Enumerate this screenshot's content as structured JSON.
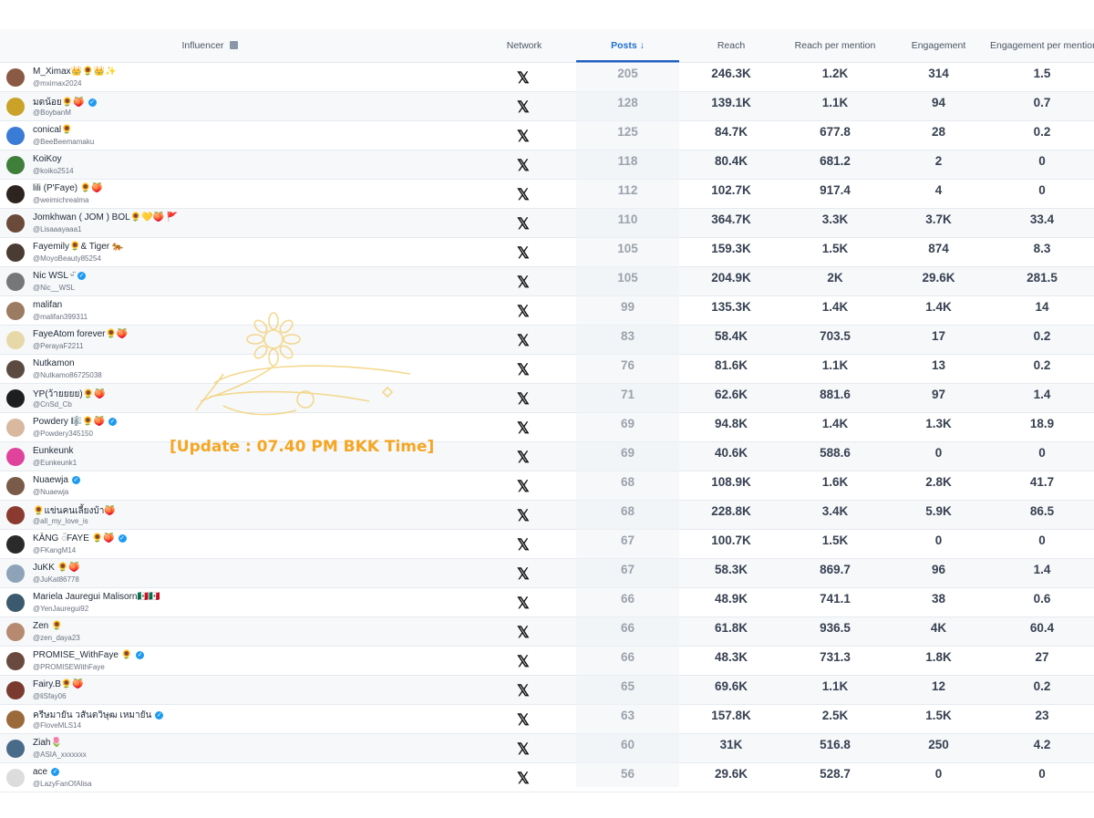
{
  "header": {
    "influencer": "Influencer",
    "network": "Network",
    "posts": "Posts",
    "posts_sort_icon": "arrow-down-icon",
    "reach": "Reach",
    "reach_per_mention": "Reach per mention",
    "engagement": "Engagement",
    "engagement_per_mention": "Engagement per mention"
  },
  "network_icon": "x-logo-icon",
  "network_glyph": "𝕏",
  "verified_glyph": "✓",
  "overlay_text": "[Update : 07.40 PM BKK Time]",
  "colors": {
    "accent": "#1f6fd1",
    "verified": "#1d9bf0",
    "overlay": "#f5a623"
  },
  "rows": [
    {
      "name": "M_Ximax👑🌻👑✨",
      "handle": "@mximax2024",
      "verified": false,
      "avatar": "#8a5a44",
      "posts": "205",
      "reach": "246.3K",
      "rpm": "1.2K",
      "eng": "314",
      "epm": "1.5"
    },
    {
      "name": "มดน้อย🌻🍑",
      "handle": "@BoybanM",
      "verified": true,
      "avatar": "#c9a227",
      "posts": "128",
      "reach": "139.1K",
      "rpm": "1.1K",
      "eng": "94",
      "epm": "0.7"
    },
    {
      "name": "conical🌻",
      "handle": "@BeeBeemamaku",
      "verified": false,
      "avatar": "#3a7bd5",
      "posts": "125",
      "reach": "84.7K",
      "rpm": "677.8",
      "eng": "28",
      "epm": "0.2"
    },
    {
      "name": "KoiKoy",
      "handle": "@koiko2514",
      "verified": false,
      "avatar": "#3f7f3a",
      "posts": "118",
      "reach": "80.4K",
      "rpm": "681.2",
      "eng": "2",
      "epm": "0"
    },
    {
      "name": "lili (P'Faye) 🌻🍑",
      "handle": "@weimichrealma",
      "verified": false,
      "avatar": "#2d2420",
      "posts": "112",
      "reach": "102.7K",
      "rpm": "917.4",
      "eng": "4",
      "epm": "0"
    },
    {
      "name": "Jomkhwan ( JOM ) BOL🌻💛🍑 🚩",
      "handle": "@Lisaaayaaa1",
      "verified": false,
      "avatar": "#6b4a3a",
      "posts": "110",
      "reach": "364.7K",
      "rpm": "3.3K",
      "eng": "3.7K",
      "epm": "33.4"
    },
    {
      "name": "Fayemily🌻& Tiger 🐅",
      "handle": "@MoyoBeauty85254",
      "verified": false,
      "avatar": "#4a3b33",
      "posts": "105",
      "reach": "159.3K",
      "rpm": "1.5K",
      "eng": "874",
      "epm": "8.3"
    },
    {
      "name": "Nic WSL ᵕ̈",
      "handle": "@Nic__WSL",
      "verified": true,
      "avatar": "#777777",
      "posts": "105",
      "reach": "204.9K",
      "rpm": "2K",
      "eng": "29.6K",
      "epm": "281.5"
    },
    {
      "name": "malifan",
      "handle": "@malifan399311",
      "verified": false,
      "avatar": "#9b7b62",
      "posts": "99",
      "reach": "135.3K",
      "rpm": "1.4K",
      "eng": "1.4K",
      "epm": "14"
    },
    {
      "name": "FayeAtom forever🌻🍑",
      "handle": "@PerayaF2211",
      "verified": false,
      "avatar": "#e7d8a8",
      "posts": "83",
      "reach": "58.4K",
      "rpm": "703.5",
      "eng": "17",
      "epm": "0.2"
    },
    {
      "name": "Nutkamon",
      "handle": "@Nutkamo86725038",
      "verified": false,
      "avatar": "#5c4a40",
      "posts": "76",
      "reach": "81.6K",
      "rpm": "1.1K",
      "eng": "13",
      "epm": "0.2"
    },
    {
      "name": "YP(ว้ายยยย)🌻🍑",
      "handle": "@CnSd_Cb",
      "verified": false,
      "avatar": "#1e1e1e",
      "posts": "71",
      "reach": "62.6K",
      "rpm": "881.6",
      "eng": "97",
      "epm": "1.4"
    },
    {
      "name": "Powdery 🎼🌻🍑",
      "handle": "@Powdery345150",
      "verified": true,
      "avatar": "#d9b8a0",
      "posts": "69",
      "reach": "94.8K",
      "rpm": "1.4K",
      "eng": "1.3K",
      "epm": "18.9"
    },
    {
      "name": "Eunkeunk",
      "handle": "@Eunkeunk1",
      "verified": false,
      "avatar": "#e0439b",
      "posts": "69",
      "reach": "40.6K",
      "rpm": "588.6",
      "eng": "0",
      "epm": "0"
    },
    {
      "name": "Nuaewja",
      "handle": "@Nuaewja",
      "verified": true,
      "avatar": "#7a5a48",
      "posts": "68",
      "reach": "108.9K",
      "rpm": "1.6K",
      "eng": "2.8K",
      "epm": "41.7"
    },
    {
      "name": "🌻แข่นคนเลี้ยงบ้า🍑",
      "handle": "@all_my_love_is",
      "verified": false,
      "avatar": "#8a3a2e",
      "posts": "68",
      "reach": "228.8K",
      "rpm": "3.4K",
      "eng": "5.9K",
      "epm": "86.5"
    },
    {
      "name": "KĀNG ◌̈FAYE 🌻🍑",
      "handle": "@FKangM14",
      "verified": true,
      "avatar": "#2a2a2a",
      "posts": "67",
      "reach": "100.7K",
      "rpm": "1.5K",
      "eng": "0",
      "epm": "0"
    },
    {
      "name": "JuKK 🌻🍑",
      "handle": "@JuKat86778",
      "verified": false,
      "avatar": "#8fa3b8",
      "posts": "67",
      "reach": "58.3K",
      "rpm": "869.7",
      "eng": "96",
      "epm": "1.4"
    },
    {
      "name": "Mariela Jauregui Malisorn🇲🇽🇲🇽",
      "handle": "@YenJauregui92",
      "verified": false,
      "avatar": "#3c5a6e",
      "posts": "66",
      "reach": "48.9K",
      "rpm": "741.1",
      "eng": "38",
      "epm": "0.6"
    },
    {
      "name": "Zen 🌻",
      "handle": "@zen_daya23",
      "verified": false,
      "avatar": "#b58a70",
      "posts": "66",
      "reach": "61.8K",
      "rpm": "936.5",
      "eng": "4K",
      "epm": "60.4"
    },
    {
      "name": "PROMISE_WithFaye 🌻",
      "handle": "@PROMISEWithFaye",
      "verified": true,
      "avatar": "#6a4a3e",
      "posts": "66",
      "reach": "48.3K",
      "rpm": "731.3",
      "eng": "1.8K",
      "epm": "27"
    },
    {
      "name": "Fairy.B🌻🍑",
      "handle": "@liSfay06",
      "verified": false,
      "avatar": "#7a3a30",
      "posts": "65",
      "reach": "69.6K",
      "rpm": "1.1K",
      "eng": "12",
      "epm": "0.2"
    },
    {
      "name": "ครีษมายัน วสันตวิษุฒ เหมายัน",
      "handle": "@FloveMLS14",
      "verified": true,
      "avatar": "#9a6a3a",
      "posts": "63",
      "reach": "157.8K",
      "rpm": "2.5K",
      "eng": "1.5K",
      "epm": "23"
    },
    {
      "name": "Ziah🌷",
      "handle": "@ASIA_xxxxxxx",
      "verified": false,
      "avatar": "#4a6a8a",
      "posts": "60",
      "reach": "31K",
      "rpm": "516.8",
      "eng": "250",
      "epm": "4.2"
    },
    {
      "name": "ace",
      "handle": "@LazyFanOfAlisa",
      "verified": true,
      "avatar": "#dcdcdc",
      "posts": "56",
      "reach": "29.6K",
      "rpm": "528.7",
      "eng": "0",
      "epm": "0"
    }
  ]
}
